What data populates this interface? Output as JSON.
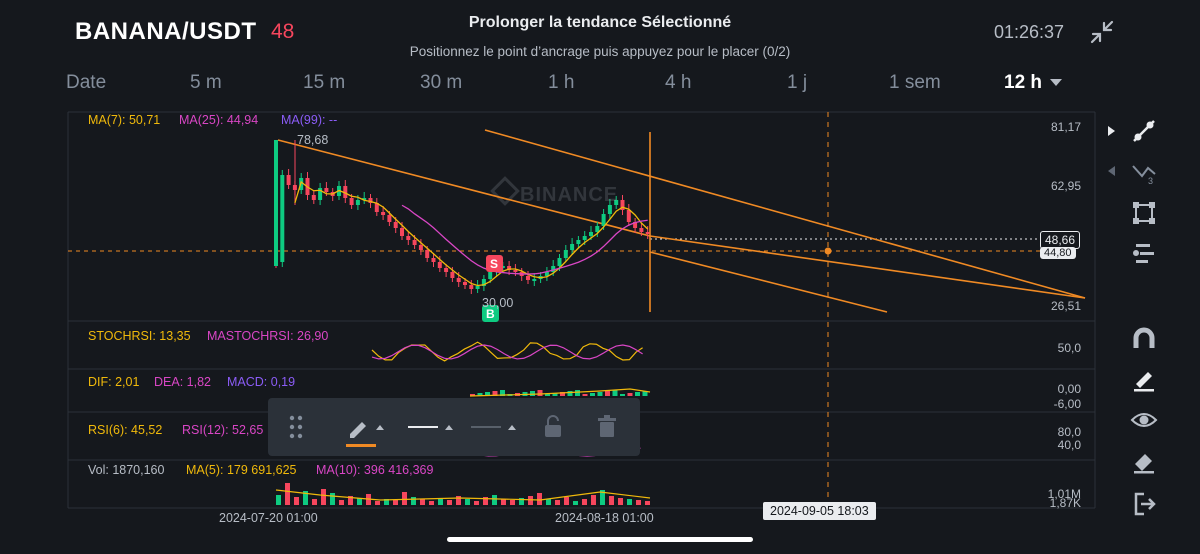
{
  "header": {
    "pair": "BANANA/USDT",
    "count": "48",
    "title": "Prolonger la tendance Sélectionné",
    "subtitle": "Positionnez le point d’ancrage puis appuyez pour le placer (0/2)",
    "time": "01:26:37"
  },
  "tabs": [
    {
      "label": "Date"
    },
    {
      "label": "5 m"
    },
    {
      "label": "15 m"
    },
    {
      "label": "30 m"
    },
    {
      "label": "1 h"
    },
    {
      "label": "4 h"
    },
    {
      "label": "1 j"
    },
    {
      "label": "1 sem"
    },
    {
      "label": "12 h",
      "active": true
    }
  ],
  "main": {
    "ma7": "MA(7): 50,71",
    "ma25": "MA(25): 44,94",
    "ma99": "MA(99): --",
    "high_label": "78,68",
    "low_label": "30,00",
    "watermark": "BINANCE",
    "y_labels": [
      "81,17",
      "62,95",
      "26,51"
    ],
    "current_price": "48,66",
    "cursor_price": "44,80",
    "sell_marker": "S",
    "buy_marker": "B"
  },
  "stochrsi": {
    "label": "STOCHRSI: 13,35",
    "mastochrsi": "MASTOCHRSI: 26,90",
    "y_label": "50,0"
  },
  "macd": {
    "dif": "DIF: 2,01",
    "dea": "DEA: 1,82",
    "macd": "MACD: 0,19",
    "y_top": "0,00",
    "y_bottom": "-6,00"
  },
  "rsi": {
    "rsi6": "RSI(6): 45,52",
    "rsi12": "RSI(12): 52,65",
    "y_top": "80,0",
    "y_bottom": "40,0"
  },
  "volume": {
    "vol": "Vol: 1870,160",
    "ma5": "MA(5): 179 691,625",
    "ma10": "MA(10): 396 416,369",
    "y_top": "1,01M",
    "y_bottom": "1,87K"
  },
  "x_axis": {
    "date1": "2024-07-20 01:00",
    "date2": "2024-08-18 01:00",
    "cursor_date": "2024-09-05 18:03"
  },
  "icons": {
    "collapse": "collapse-icon",
    "sidebar": [
      "trend-line-icon",
      "fib-icon",
      "rectangle-icon",
      "position-icon",
      "magnet-icon",
      "brush-icon",
      "eye-icon",
      "eraser-icon",
      "exit-icon"
    ],
    "toolbar": [
      "drag-handle-icon",
      "pencil-icon",
      "line-solid-icon",
      "line-thin-icon",
      "lock-icon",
      "trash-icon"
    ]
  },
  "colors": {
    "background": "#15181d",
    "up": "#0ecb81",
    "down": "#f6465d",
    "ma7": "#f0b90b",
    "ma25": "#d946c5",
    "ma99": "#8b5cf6",
    "trend": "#f08a24"
  }
}
